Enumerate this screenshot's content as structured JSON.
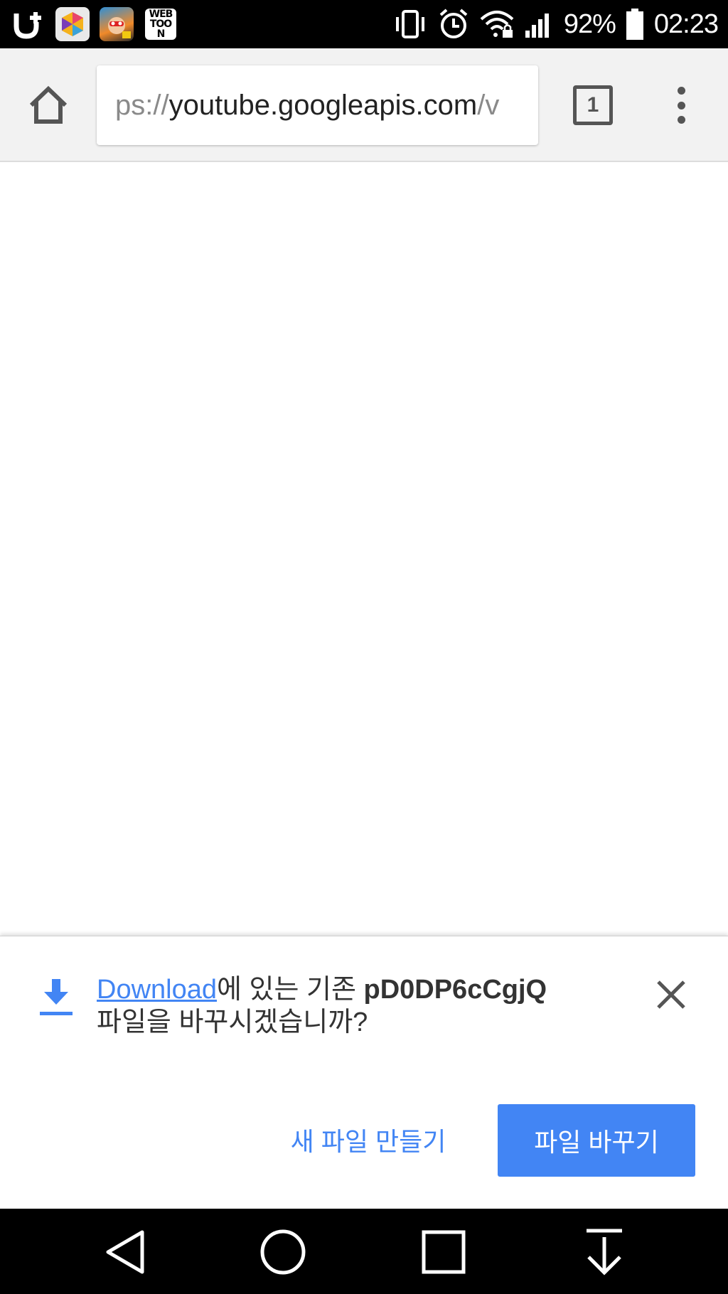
{
  "status_bar": {
    "battery_percent": "92%",
    "time": "02:23",
    "notification_icons": [
      "uplus-icon",
      "hexagon-app-icon",
      "netmarble-game-icon",
      "webtoon-icon"
    ],
    "webtoon_label": "WEB TOON",
    "system_icons": [
      "vibrate-icon",
      "alarm-icon",
      "wifi-locked-icon",
      "signal-icon",
      "battery-icon"
    ]
  },
  "toolbar": {
    "url_scheme": "ps://",
    "url_host": "youtube.googleapis.com",
    "url_rest": "/v",
    "tab_count": "1"
  },
  "infobar": {
    "link_text": "Download",
    "message_part1": "에 있는 기존 ",
    "filename": "pD0DP6cCgjQ",
    "message_part2": "파일을 바꾸시겠습니까?",
    "new_file_label": "새 파일 만들기",
    "replace_label": "파일 바꾸기",
    "accent_color": "#4285f4"
  },
  "nav_bar": {
    "buttons": [
      "back-icon",
      "home-circle-icon",
      "recents-icon",
      "notification-pull-icon"
    ]
  }
}
